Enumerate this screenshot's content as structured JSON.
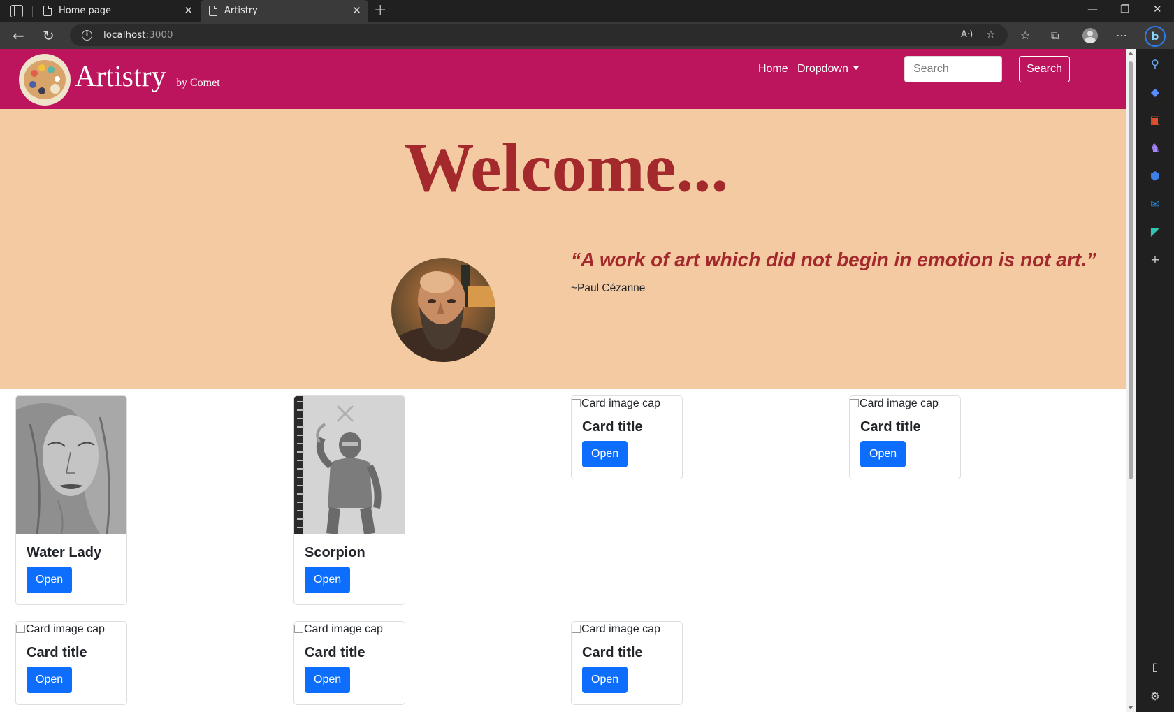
{
  "browser": {
    "tabs": [
      {
        "title": "Home page",
        "active": false
      },
      {
        "title": "Artistry",
        "active": true
      }
    ],
    "new_tab": "+",
    "url_host": "localhost",
    "url_port": ":3000",
    "window_controls": {
      "minimize": "—",
      "restore": "❐",
      "close": "✕"
    },
    "accent": "#2d7cf0"
  },
  "site": {
    "brand": "Artistry",
    "brand_by": "by Comet",
    "nav": {
      "home": "Home",
      "dropdown": "Dropdown"
    },
    "search_placeholder": "Search",
    "search_button": "Search",
    "navbar_color": "#bd155d",
    "hero_color": "#f4caa2"
  },
  "hero": {
    "heading": "Welcome...",
    "quote": "“A work of art which did not begin in emotion is not art.”",
    "author": "~Paul Cézanne"
  },
  "cards": [
    {
      "title": "Water Lady",
      "image": "pencil-drawing-woman",
      "button": "Open"
    },
    {
      "title": "Scorpion",
      "image": "pencil-drawing-ninja",
      "button": "Open"
    },
    {
      "title": "Card title",
      "image_alt": "Card image cap",
      "button": "Open"
    },
    {
      "title": "Card title",
      "image_alt": "Card image cap",
      "button": "Open"
    },
    {
      "title": "Card title",
      "image_alt": "Card image cap",
      "button": "Open"
    },
    {
      "title": "Card title",
      "image_alt": "Card image cap",
      "button": "Open"
    },
    {
      "title": "Card title",
      "image_alt": "Card image cap",
      "button": "Open"
    }
  ],
  "button_color": "#0d6efd"
}
